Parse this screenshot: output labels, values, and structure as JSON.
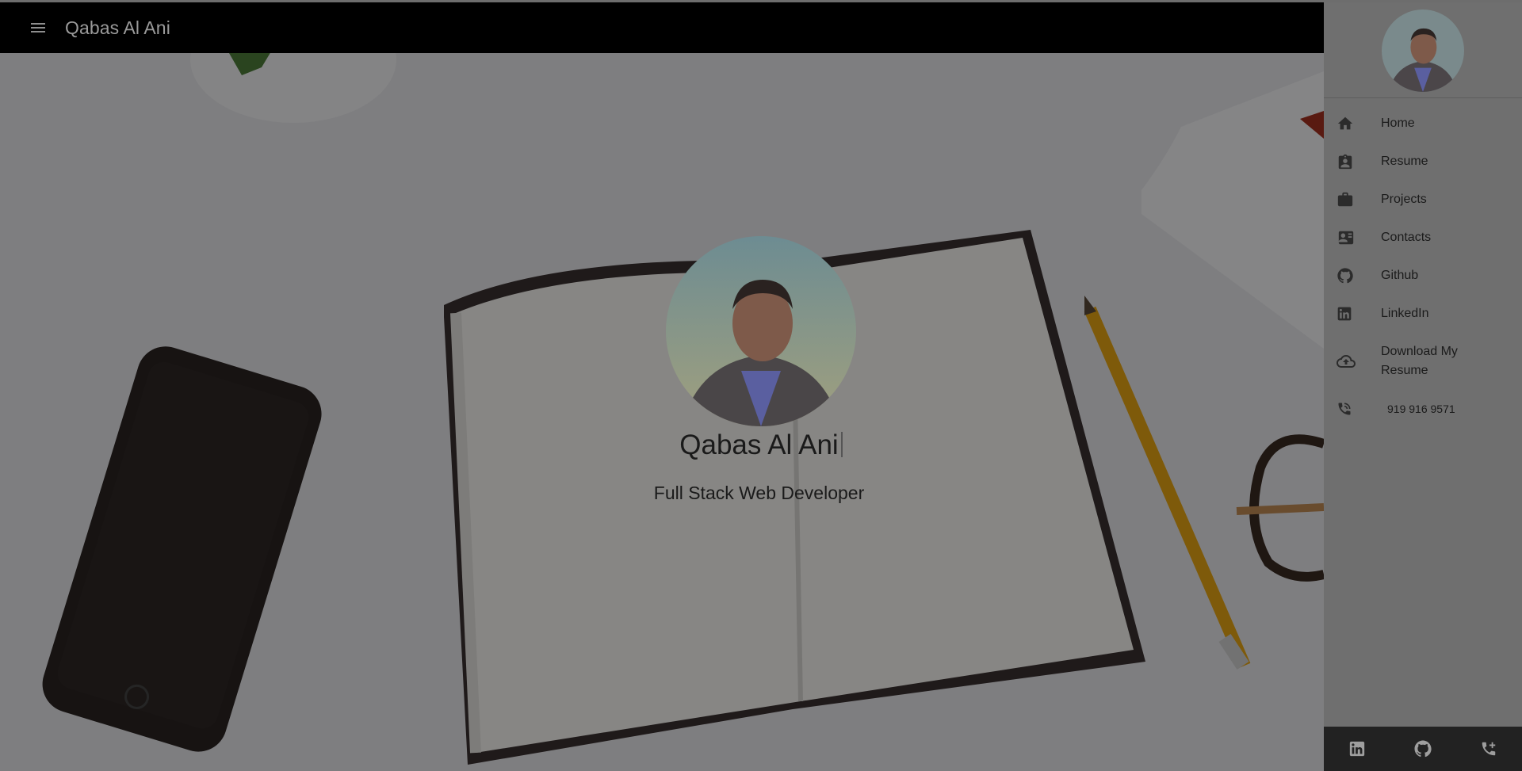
{
  "app_bar": {
    "title": "Qabas Al Ani",
    "menu_icon": "menu-icon"
  },
  "hero": {
    "name": "Qabas Al Ani",
    "role": "Full Stack Web Developer"
  },
  "drawer": {
    "nav_items": [
      {
        "label": "Home",
        "icon": "home-icon"
      },
      {
        "label": "Resume",
        "icon": "resume-badge-icon"
      },
      {
        "label": "Projects",
        "icon": "briefcase-icon"
      },
      {
        "label": "Contacts",
        "icon": "contact-card-icon"
      },
      {
        "label": "Github",
        "icon": "github-icon"
      },
      {
        "label": "LinkedIn",
        "icon": "linkedin-icon"
      },
      {
        "label": "Download My Resume",
        "icon": "cloud-upload-icon"
      },
      {
        "label": "919 916 9571",
        "icon": "phone-icon"
      }
    ],
    "footer_icons": [
      "linkedin-icon",
      "github-icon",
      "phone-add-icon"
    ]
  },
  "colors": {
    "app_bar_bg": "#000000",
    "drawer_bg": "#6f6f6f",
    "drawer_footer_bg": "#222222",
    "icon_color": "#2b2b2b",
    "footer_icon_color": "#9e9e9e"
  }
}
